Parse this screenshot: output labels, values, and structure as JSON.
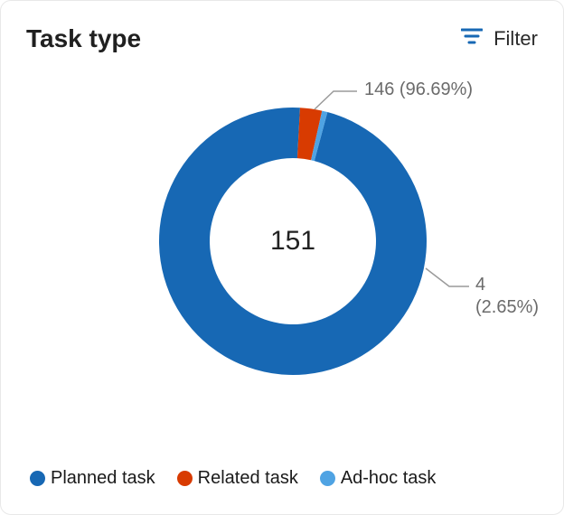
{
  "header": {
    "title": "Task type",
    "filter_label": "Filter"
  },
  "center_total": "151",
  "callouts": {
    "top": {
      "text": "146 (96.69%)"
    },
    "right": {
      "line1": "4",
      "line2": "(2.65%)"
    }
  },
  "legend": [
    {
      "label": "Planned task",
      "color": "#1768b4"
    },
    {
      "label": "Related task",
      "color": "#d83b01"
    },
    {
      "label": "Ad-hoc task",
      "color": "#4fa3e3"
    }
  ],
  "chart_data": {
    "type": "pie",
    "title": "Task type",
    "total": 151,
    "series": [
      {
        "name": "Planned task",
        "value": 146,
        "percent": 96.69,
        "color": "#1768b4"
      },
      {
        "name": "Related task",
        "value": 4,
        "percent": 2.65,
        "color": "#d83b01"
      },
      {
        "name": "Ad-hoc task",
        "value": 1,
        "percent": 0.66,
        "color": "#4fa3e3"
      }
    ]
  }
}
